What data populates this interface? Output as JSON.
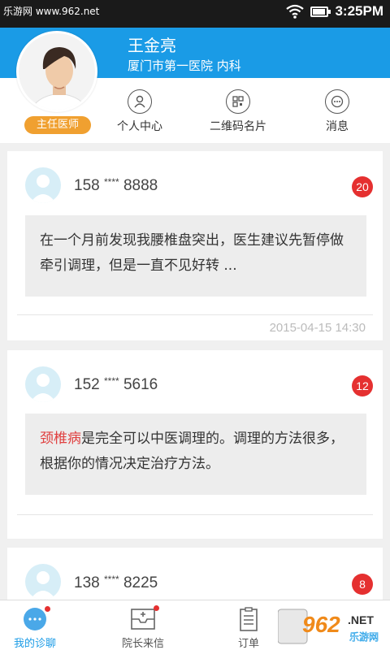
{
  "status_bar": {
    "watermark": "乐游网 www.962.net",
    "time": "3:25PM"
  },
  "profile": {
    "name": "王金亮",
    "organization": "厦门市第一医院  内科",
    "title_badge": "主任医师"
  },
  "header_nav": [
    {
      "label": "个人中心",
      "icon": "person-icon"
    },
    {
      "label": "二维码名片",
      "icon": "qr-code-icon"
    },
    {
      "label": "消息",
      "icon": "chat-icon"
    }
  ],
  "messages": [
    {
      "phone_prefix": "158",
      "phone_mask": "****",
      "phone_suffix": "8888",
      "unread": "20",
      "text": "在一个月前发现我腰椎盘突出，医生建议先暂停做牵引调理，但是一直不见好转 ...",
      "time": "2015-04-15  14:30"
    },
    {
      "phone_prefix": "152",
      "phone_mask": "****",
      "phone_suffix": "5616",
      "unread": "12",
      "highlight": "颈椎病",
      "text": "是完全可以中医调理的。调理的方法很多，根据你的情况决定治疗方法。"
    },
    {
      "phone_prefix": "138",
      "phone_mask": "****",
      "phone_suffix": "8225",
      "unread": "8"
    }
  ],
  "bottom_nav": [
    {
      "label": "我的诊聊",
      "icon": "chat-bubble-icon",
      "active": true
    },
    {
      "label": "院长来信",
      "icon": "mail-icon"
    },
    {
      "label": "订单",
      "icon": "clipboard-icon"
    }
  ],
  "brand_overlay": {
    "number": "962",
    "suffix": ".NET",
    "name": "乐游网"
  },
  "colors": {
    "primary": "#1a9be6",
    "badge_orange": "#f0a030",
    "unread_red": "#e53030",
    "highlight_red": "#e04040"
  }
}
